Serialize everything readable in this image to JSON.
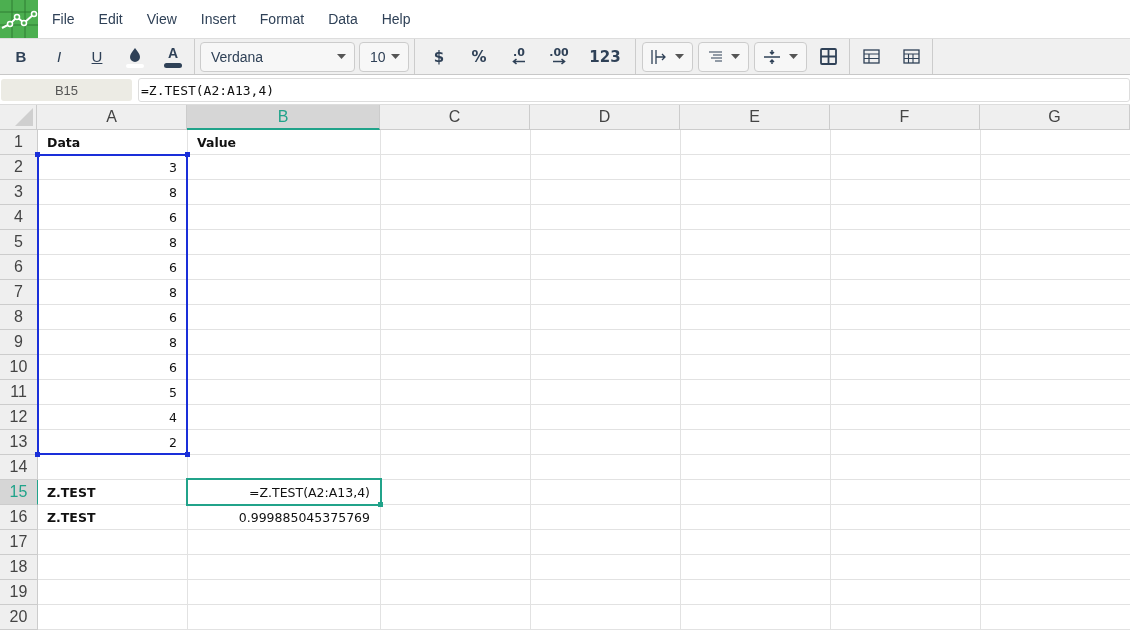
{
  "menu": [
    "File",
    "Edit",
    "View",
    "Insert",
    "Format",
    "Data",
    "Help"
  ],
  "toolbar": {
    "style_buttons": [
      {
        "kind": "bold",
        "label": "B"
      },
      {
        "kind": "italic",
        "label": "I"
      },
      {
        "kind": "underline",
        "label": "U"
      }
    ],
    "text_color_label": "A",
    "font": "Verdana",
    "size": "10",
    "number_buttons": [
      {
        "kind": "currency",
        "label": "$"
      },
      {
        "kind": "percent",
        "label": "%"
      },
      {
        "kind": "decrease_decimals",
        "label": ".0"
      },
      {
        "kind": "increase_decimals",
        "label": ".00"
      },
      {
        "kind": "format",
        "label": "123"
      }
    ]
  },
  "name_box": "B15",
  "formula": "=Z.TEST(A2:A13,4)",
  "columns": [
    {
      "label": "A",
      "selected": false
    },
    {
      "label": "B",
      "selected": true
    },
    {
      "label": "C",
      "selected": false
    },
    {
      "label": "D",
      "selected": false
    },
    {
      "label": "E",
      "selected": false
    },
    {
      "label": "F",
      "selected": false
    },
    {
      "label": "G",
      "selected": false
    }
  ],
  "rows": [
    {
      "label": "1",
      "selected": false,
      "cells": [
        {
          "value": "Data",
          "kind": "label"
        },
        {
          "value": "Value",
          "kind": "label"
        }
      ]
    },
    {
      "label": "2",
      "selected": false,
      "cells": [
        {
          "value": "3",
          "kind": "number",
          "in_range": true
        }
      ]
    },
    {
      "label": "3",
      "selected": false,
      "cells": [
        {
          "value": "8",
          "kind": "number",
          "in_range": true
        }
      ]
    },
    {
      "label": "4",
      "selected": false,
      "cells": [
        {
          "value": "6",
          "kind": "number",
          "in_range": true
        }
      ]
    },
    {
      "label": "5",
      "selected": false,
      "cells": [
        {
          "value": "8",
          "kind": "number",
          "in_range": true
        }
      ]
    },
    {
      "label": "6",
      "selected": false,
      "cells": [
        {
          "value": "6",
          "kind": "number",
          "in_range": true
        }
      ]
    },
    {
      "label": "7",
      "selected": false,
      "cells": [
        {
          "value": "8",
          "kind": "number",
          "in_range": true
        }
      ]
    },
    {
      "label": "8",
      "selected": false,
      "cells": [
        {
          "value": "6",
          "kind": "number",
          "in_range": true
        }
      ]
    },
    {
      "label": "9",
      "selected": false,
      "cells": [
        {
          "value": "8",
          "kind": "number",
          "in_range": true
        }
      ]
    },
    {
      "label": "10",
      "selected": false,
      "cells": [
        {
          "value": "6",
          "kind": "number",
          "in_range": true
        }
      ]
    },
    {
      "label": "11",
      "selected": false,
      "cells": [
        {
          "value": "5",
          "kind": "number",
          "in_range": true
        }
      ]
    },
    {
      "label": "12",
      "selected": false,
      "cells": [
        {
          "value": "4",
          "kind": "number",
          "in_range": true
        }
      ]
    },
    {
      "label": "13",
      "selected": false,
      "cells": [
        {
          "value": "2",
          "kind": "number",
          "in_range": true
        }
      ]
    },
    {
      "label": "14",
      "selected": false,
      "cells": []
    },
    {
      "label": "15",
      "selected": true,
      "cells": [
        {
          "value": "Z.TEST",
          "kind": "label"
        },
        {
          "value": "=Z.TEST(A2:A13,4)",
          "kind": "number",
          "active": true
        }
      ]
    },
    {
      "label": "16",
      "selected": false,
      "cells": [
        {
          "value": "Z.TEST",
          "kind": "label"
        },
        {
          "value": "0.999885045375769",
          "kind": "number"
        }
      ]
    },
    {
      "label": "17",
      "selected": false,
      "cells": []
    },
    {
      "label": "18",
      "selected": false,
      "cells": []
    },
    {
      "label": "19",
      "selected": false,
      "cells": []
    },
    {
      "label": "20",
      "selected": false,
      "cells": []
    }
  ]
}
